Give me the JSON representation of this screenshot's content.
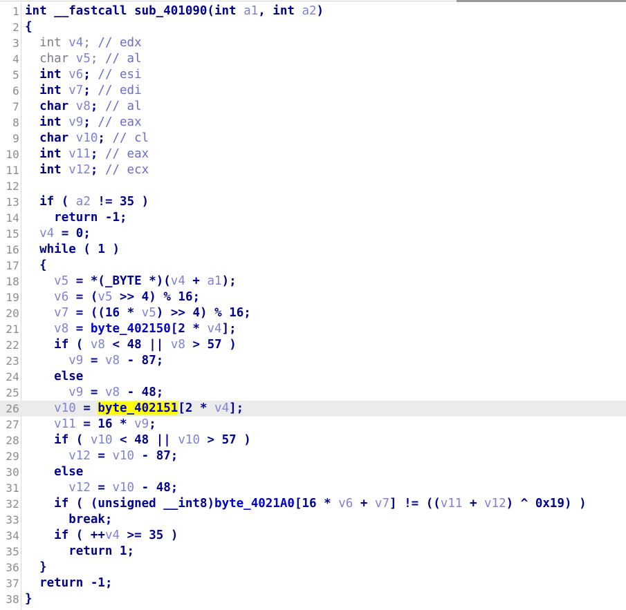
{
  "window": {
    "view_name": "Hex-Rays Pseudocode",
    "top_divider_color": "#d2d2d2",
    "top_scrollbar_color": "#9a9a9a"
  },
  "editor": {
    "current_line": 26,
    "highlight_row_color": "#ebebeb",
    "highlight_token_color": "#ffff00",
    "highlighted_token": "byte_402151",
    "gutter_color": "#8c8c8c",
    "background": "#ffffff",
    "colors": {
      "keyword": "#00008f",
      "local_variable": "#8080d8",
      "global_variable": "#0000cf",
      "comment": "#6a6ad0",
      "dim_text": "#7b7b86"
    }
  },
  "function": {
    "signature": "int __fastcall sub_401090(int a1, int a2)",
    "name": "sub_401090",
    "return_type": "int",
    "calling_convention": "__fastcall",
    "parameters": [
      "int a1",
      "int a2"
    ],
    "total_lines": 38
  },
  "code": {
    "lines": [
      {
        "n": 1,
        "text": "int __fastcall sub_401090(int a1, int a2)"
      },
      {
        "n": 2,
        "text": "{"
      },
      {
        "n": 3,
        "text": "  int v4; // edx"
      },
      {
        "n": 4,
        "text": "  char v5; // al"
      },
      {
        "n": 5,
        "text": "  int v6; // esi"
      },
      {
        "n": 6,
        "text": "  int v7; // edi"
      },
      {
        "n": 7,
        "text": "  char v8; // al"
      },
      {
        "n": 8,
        "text": "  int v9; // eax"
      },
      {
        "n": 9,
        "text": "  char v10; // cl"
      },
      {
        "n": 10,
        "text": "  int v11; // eax"
      },
      {
        "n": 11,
        "text": "  int v12; // ecx"
      },
      {
        "n": 12,
        "text": ""
      },
      {
        "n": 13,
        "text": "  if ( a2 != 35 )"
      },
      {
        "n": 14,
        "text": "    return -1;"
      },
      {
        "n": 15,
        "text": "  v4 = 0;"
      },
      {
        "n": 16,
        "text": "  while ( 1 )"
      },
      {
        "n": 17,
        "text": "  {"
      },
      {
        "n": 18,
        "text": "    v5 = *(_BYTE *)(v4 + a1);"
      },
      {
        "n": 19,
        "text": "    v6 = (v5 >> 4) % 16;"
      },
      {
        "n": 20,
        "text": "    v7 = ((16 * v5) >> 4) % 16;"
      },
      {
        "n": 21,
        "text": "    v8 = byte_402150[2 * v4];"
      },
      {
        "n": 22,
        "text": "    if ( v8 < 48 || v8 > 57 )"
      },
      {
        "n": 23,
        "text": "      v9 = v8 - 87;"
      },
      {
        "n": 24,
        "text": "    else"
      },
      {
        "n": 25,
        "text": "      v9 = v8 - 48;"
      },
      {
        "n": 26,
        "text": "    v10 = byte_402151[2 * v4];"
      },
      {
        "n": 27,
        "text": "    v11 = 16 * v9;"
      },
      {
        "n": 28,
        "text": "    if ( v10 < 48 || v10 > 57 )"
      },
      {
        "n": 29,
        "text": "      v12 = v10 - 87;"
      },
      {
        "n": 30,
        "text": "    else"
      },
      {
        "n": 31,
        "text": "      v12 = v10 - 48;"
      },
      {
        "n": 32,
        "text": "    if ( (unsigned __int8)byte_4021A0[16 * v6 + v7] != ((v11 + v12) ^ 0x19) )"
      },
      {
        "n": 33,
        "text": "      break;"
      },
      {
        "n": 34,
        "text": "    if ( ++v4 >= 35 )"
      },
      {
        "n": 35,
        "text": "      return 1;"
      },
      {
        "n": 36,
        "text": "  }"
      },
      {
        "n": 37,
        "text": "  return -1;"
      },
      {
        "n": 38,
        "text": "}"
      }
    ]
  },
  "symbols": {
    "locals": [
      "v4",
      "v5",
      "v6",
      "v7",
      "v8",
      "v9",
      "v10",
      "v11",
      "v12"
    ],
    "arguments": [
      "a1",
      "a2"
    ],
    "globals": [
      "byte_402150",
      "byte_402151",
      "byte_4021A0"
    ],
    "register_comments": [
      "edx",
      "al",
      "esi",
      "edi",
      "al",
      "eax",
      "cl",
      "eax",
      "ecx"
    ],
    "keywords": [
      "int",
      "char",
      "if",
      "else",
      "return",
      "while",
      "break",
      "unsigned",
      "__int8",
      "_BYTE"
    ]
  }
}
